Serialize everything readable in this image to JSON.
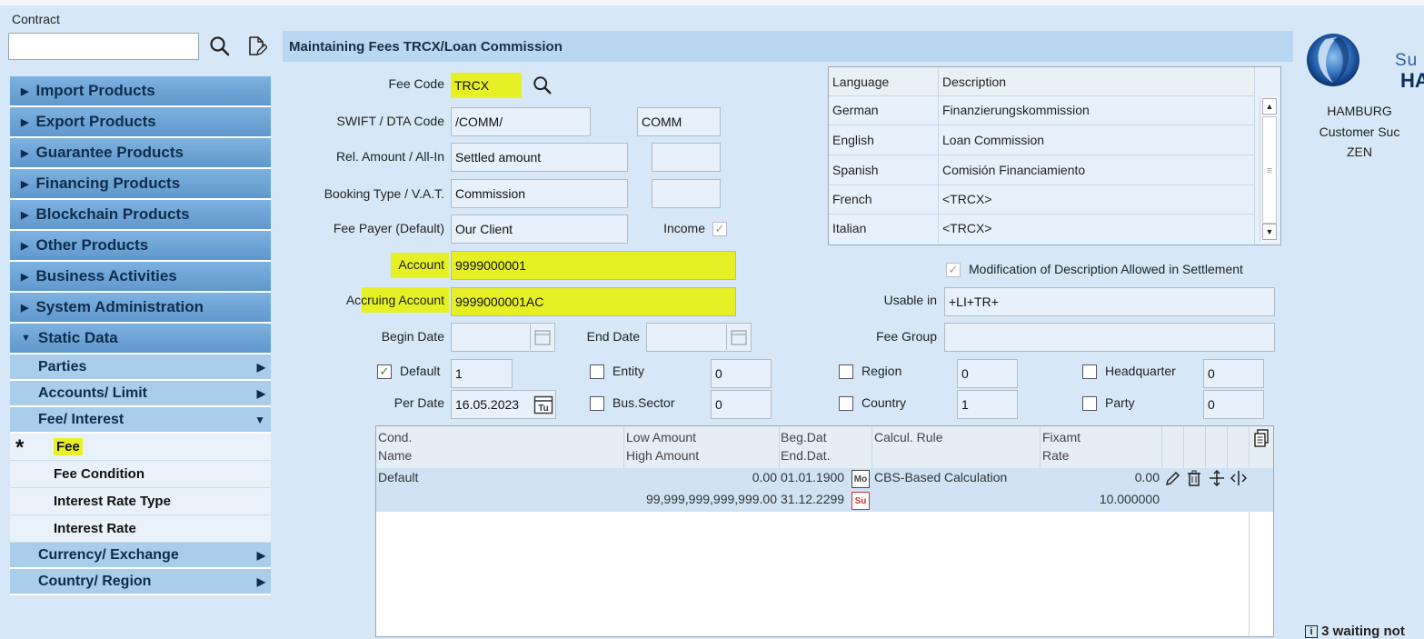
{
  "contract": {
    "label": "Contract",
    "value": ""
  },
  "menu": {
    "main_top": [
      "Import Products",
      "Export Products",
      "Guarantee Products",
      "Financing Products",
      "Blockchain Products",
      "Other Products",
      "Business Activities",
      "System Administration"
    ],
    "static": "Static Data",
    "sub": [
      {
        "label": "Parties",
        "arrow": "▶"
      },
      {
        "label": "Accounts/ Limit",
        "arrow": "▶"
      },
      {
        "label": "Fee/ Interest",
        "arrow": "▼"
      }
    ],
    "leaves": [
      "Fee",
      "Fee Condition",
      "Interest Rate Type",
      "Interest Rate"
    ],
    "sub_bottom": [
      {
        "label": "Currency/ Exchange",
        "arrow": "▶"
      },
      {
        "label": "Country/ Region",
        "arrow": "▶"
      }
    ],
    "current_marker": "*"
  },
  "header": {
    "title": "Maintaining Fees TRCX/Loan Commission"
  },
  "form": {
    "fee_code_label": "Fee Code",
    "fee_code": "TRCX",
    "swift_label": "SWIFT / DTA Code",
    "swift1": "/COMM/",
    "swift2": "COMM",
    "rel_label": "Rel. Amount / All-In",
    "rel_value": "Settled amount",
    "rel2": "",
    "booking_label": "Booking Type / V.A.T.",
    "booking_value": "Commission",
    "booking2": "",
    "payer_label": "Fee Payer (Default)",
    "payer_value": "Our Client",
    "income_label": "Income",
    "account_label": "Account",
    "account": "9999000001",
    "accruing_label": "Accruing Account",
    "accruing": "9999000001AC",
    "begin_label": "Begin Date",
    "begin": "",
    "end_label": "End Date",
    "end": "",
    "modif_label": "Modification of Description Allowed in Settlement",
    "usable_label": "Usable in",
    "usable": "+LI+TR+",
    "feegroup_label": "Fee Group",
    "feegroup": "",
    "default_label": "Default",
    "default_val": "1",
    "perdate_label": "Per Date",
    "perdate": "16.05.2023",
    "entity_label": "Entity",
    "entity_val": "0",
    "bus_label": "Bus.Sector",
    "bus_val": "0",
    "region_label": "Region",
    "region_val": "0",
    "country_label": "Country",
    "country_val": "1",
    "hq_label": "Headquarter",
    "hq_val": "0",
    "party_label": "Party",
    "party_val": "0"
  },
  "lang_table": {
    "headers": [
      "Language",
      "Description"
    ],
    "rows": [
      [
        "German",
        "Finanzierungskommission"
      ],
      [
        "English",
        "Loan Commission"
      ],
      [
        "Spanish",
        "Comisión Financiamiento"
      ],
      [
        "French",
        "<TRCX>"
      ],
      [
        "Italian",
        "<TRCX>"
      ]
    ]
  },
  "grid": {
    "headers": {
      "cond": "Cond.",
      "name": "Name",
      "low": "Low Amount",
      "high": "High Amount",
      "beg": "Beg.Dat",
      "end": "End.Dat.",
      "rule": "Calcul. Rule",
      "fixamt": "Fixamt",
      "rate": "Rate"
    },
    "row": {
      "name": "Default",
      "low": "0.00",
      "high": "99,999,999,999,999.00",
      "beg": "01.01.1900",
      "end": "31.12.2299",
      "beg_badge": "Mo",
      "end_badge": "Su",
      "rule": "CBS-Based Calculation",
      "fixamt": "0.00",
      "rate": "10.000000"
    }
  },
  "right": {
    "logo_text1": "Su",
    "logo_text2": "HA",
    "line1": "HAMBURG",
    "line2": "Customer Suc",
    "line3": "ZEN",
    "waiting": "3 waiting not"
  }
}
